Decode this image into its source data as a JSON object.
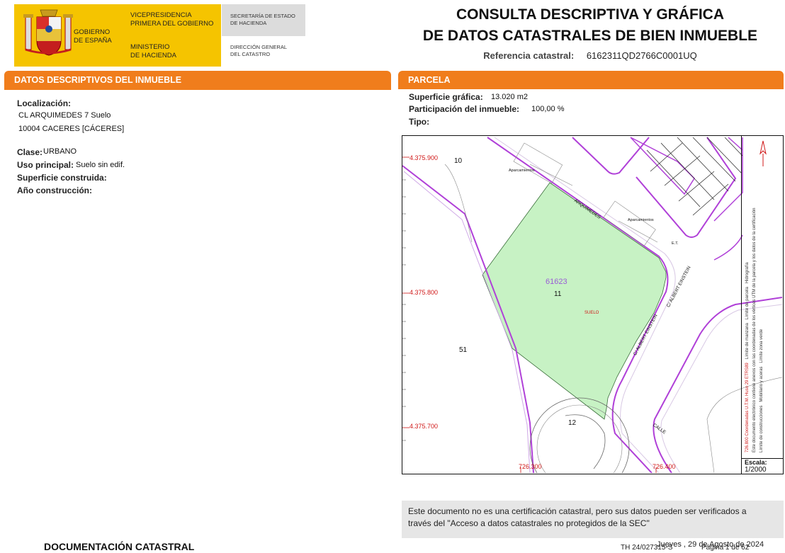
{
  "header": {
    "gov_line1": "GOBIERNO",
    "gov_line2": "DE ESPAÑA",
    "vice_line1": "VICEPRESIDENCIA",
    "vice_line2": "PRIMERA DEL GOBIERNO",
    "min_line1": "MINISTERIO",
    "min_line2": "DE HACIENDA",
    "sec_line1": "SECRETARÍA DE ESTADO",
    "sec_line2": "DE HACIENDA",
    "dir_line1": "DIRECCIÓN GENERAL",
    "dir_line2": "DEL CATASTRO",
    "title_line1": "CONSULTA DESCRIPTIVA Y GRÁFICA",
    "title_line2": "DE DATOS CATASTRALES DE BIEN INMUEBLE",
    "ref_label": "Referencia catastral:",
    "ref_value": "6162311QD2766C0001UQ"
  },
  "datos": {
    "section_title": "DATOS DESCRIPTIVOS DEL INMUEBLE",
    "localizacion_label": "Localización:",
    "address1": "CL ARQUIMEDES 7 Suelo",
    "address2": "10004 CACERES [CÁCERES]",
    "clase_label": "Clase:",
    "clase_value": "URBANO",
    "uso_label": "Uso principal:",
    "uso_value": "Suelo sin edif.",
    "superficie_label": "Superficie construida:",
    "anio_label": "Año construcción:"
  },
  "parcela": {
    "section_title": "PARCELA",
    "sup_label": "Superficie gráfica:",
    "sup_value": "13.020 m2",
    "part_label": "Participación del inmueble:",
    "part_value": "100,00 %",
    "tipo_label": "Tipo:"
  },
  "map": {
    "coord_y1": "4.375.900",
    "coord_y2": "4.375.800",
    "coord_y3": "4.375.700",
    "coord_x1": "726.300",
    "coord_x2": "726.400",
    "parcel_10": "10",
    "parcel_51": "51",
    "parcel_12": "12",
    "parcel_11": "11",
    "manzana": "61623",
    "suelo": "SUELO",
    "street1": "ARQUIMEDES",
    "street2": "C/ ALBERT EINSTEIN",
    "street3": "C/ ALBERT EINSTEIN",
    "street4": "CALLE",
    "apart1": "Aparcamientos",
    "apart2": "Aparcamientos",
    "et": "E.T.",
    "legend_limite_manzana": "Límite de manzana",
    "legend_limite_parcela": "Límite de parcela",
    "legend_hidrografia": "Hidrografía",
    "legend_limite_construcciones": "Límite de construcciones",
    "legend_mobiliario": "Mobiliario y aceras",
    "legend_zona_verde": "Límite zona verde",
    "legend_coords": "726.800 Coordenadas U.T.M. Huso 29 ETRS89",
    "legend_note": "Este documento electrónico contiene anexos con las coordenadas de los vértices UTM de la parcela y los datos de la certificación",
    "escala_label": "Escala:",
    "escala_value": "1/2000",
    "colors": {
      "parcel_fill": "#c7f2c4",
      "limite_manzana": "#b040d8",
      "coord_text": "#d01818",
      "orange": "#f07d1c"
    }
  },
  "disclaimer": {
    "line1": "Este documento no es una certificación catastral, pero sus datos pueden ser verificados a",
    "line2": "través del \"Acceso a datos catastrales no protegidos de la SEC\""
  },
  "footer": {
    "doc": "DOCUMENTACIÓN CATASTRAL",
    "th": "TH 24/027315-S",
    "date": "Jueves , 29 de Agosto de 2024",
    "page": "Página 1 de 62"
  }
}
